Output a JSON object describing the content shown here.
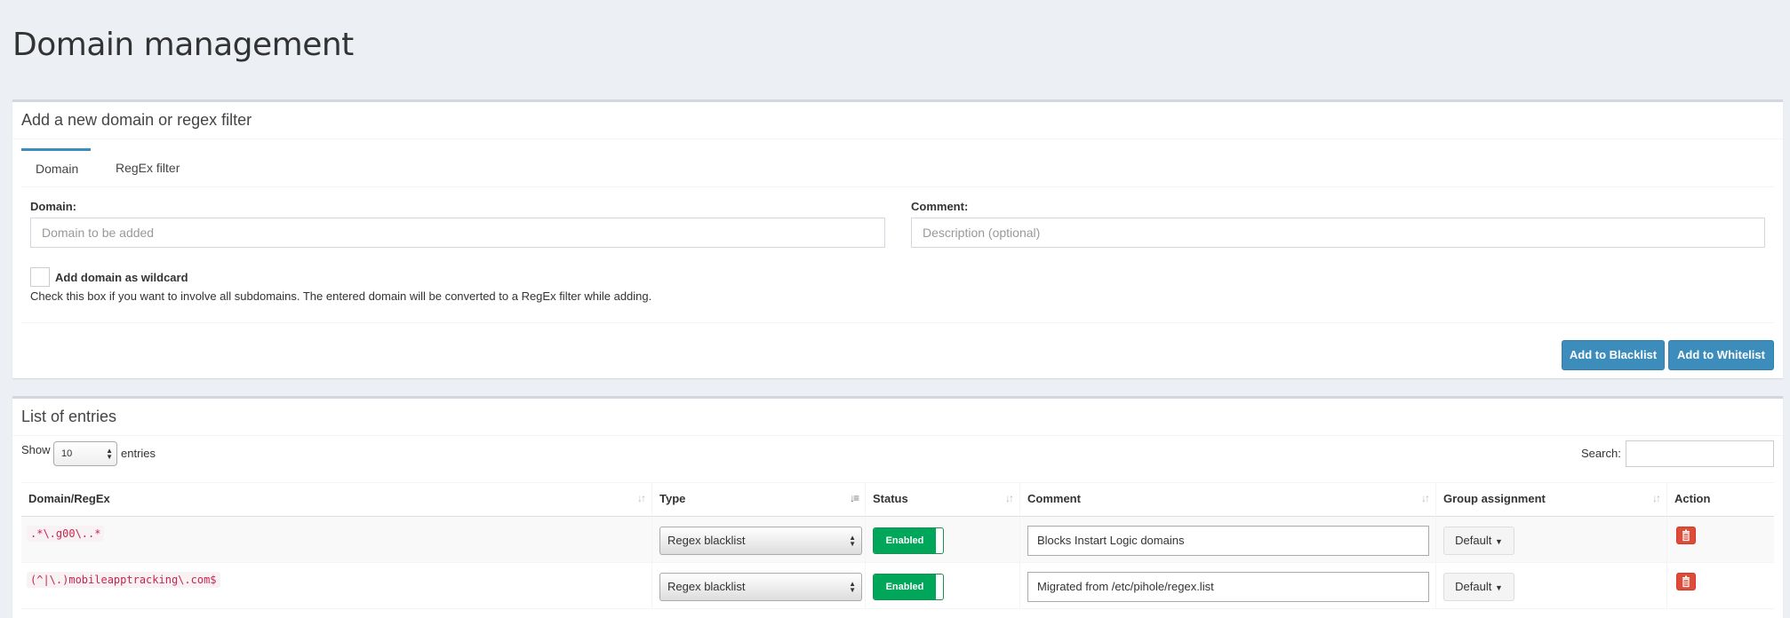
{
  "page": {
    "title": "Domain management"
  },
  "add_box": {
    "title": "Add a new domain or regex filter",
    "tabs": [
      {
        "label": "Domain"
      },
      {
        "label": "RegEx filter"
      }
    ],
    "domain_label": "Domain:",
    "domain_placeholder": "Domain to be added",
    "comment_label": "Comment:",
    "comment_placeholder": "Description (optional)",
    "wildcard_label": "Add domain as wildcard",
    "wildcard_help": "Check this box if you want to involve all subdomains. The entered domain will be converted to a RegEx filter while adding.",
    "blacklist_button": "Add to Blacklist",
    "whitelist_button": "Add to Whitelist"
  },
  "list_box": {
    "title": "List of entries",
    "show_label": "Show",
    "show_value": "10",
    "entries_label": "entries",
    "search_label": "Search:",
    "columns": [
      "Domain/RegEx",
      "Type",
      "Status",
      "Comment",
      "Group assignment",
      "Action"
    ],
    "rows": [
      {
        "domain": ".*\\.g00\\..*",
        "type": "Regex blacklist",
        "status": "Enabled",
        "comment": "Blocks Instart Logic domains",
        "group": "Default"
      },
      {
        "domain": "(^|\\.)mobileapptracking\\.com$",
        "type": "Regex blacklist",
        "status": "Enabled",
        "comment": "Migrated from /etc/pihole/regex.list",
        "group": "Default"
      }
    ]
  },
  "colors": {
    "primary": "#3c8dbc",
    "success": "#00a65a",
    "danger": "#dd4b39"
  }
}
